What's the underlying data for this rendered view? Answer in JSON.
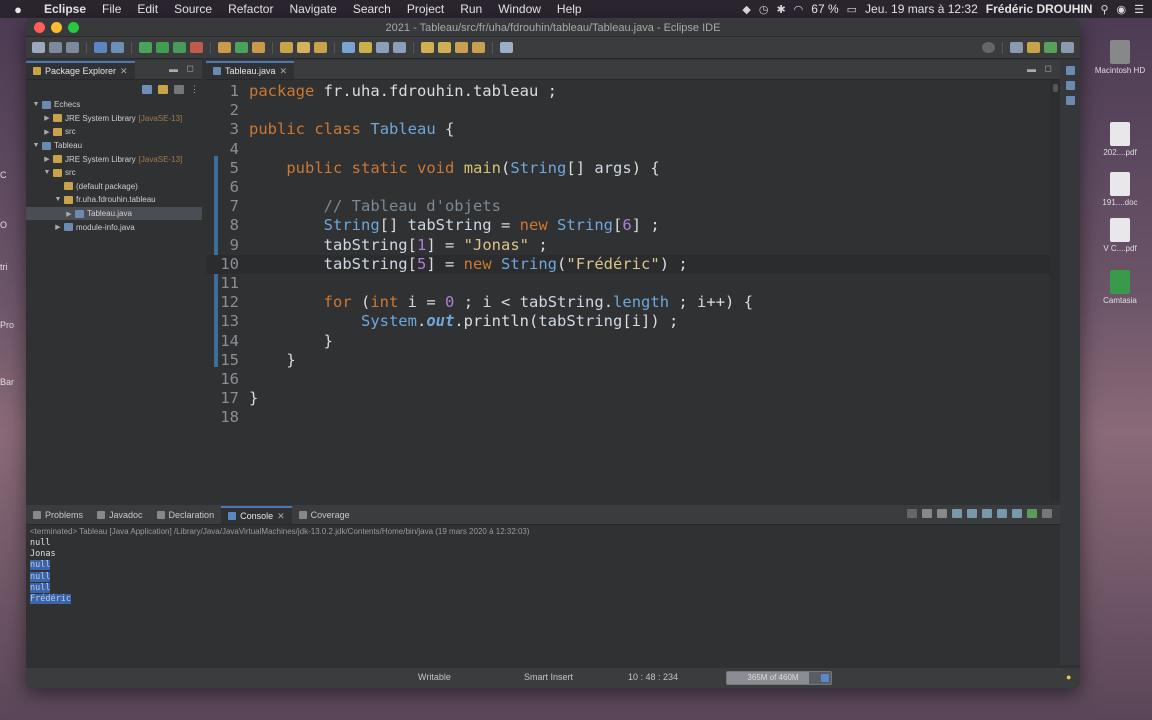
{
  "menubar": {
    "app": "Eclipse",
    "items": [
      "File",
      "Edit",
      "Source",
      "Refactor",
      "Navigate",
      "Search",
      "Project",
      "Run",
      "Window",
      "Help"
    ],
    "battery": "67 %",
    "datetime": "Jeu. 19 mars à 12:32",
    "user": "Frédéric DROUHIN"
  },
  "desktop": {
    "icons": [
      {
        "label": "Macintosh HD",
        "icon": "drive-icon"
      },
      {
        "label": "202....pdf",
        "icon": "pdf-file-icon"
      },
      {
        "label": "191....doc",
        "icon": "doc-file-icon"
      },
      {
        "label": "V C....pdf",
        "icon": "pdf-file-icon"
      },
      {
        "label": "Camtasia",
        "icon": "camtasia-icon"
      }
    ],
    "left_edge": [
      "C",
      "O",
      "tri",
      "Pro",
      "Bar"
    ]
  },
  "window": {
    "title": "2021 - Tableau/src/fr/uha/fdrouhin/tableau/Tableau.java - Eclipse IDE"
  },
  "package_explorer": {
    "tab_label": "Package Explorer",
    "tree": [
      {
        "label": "Echecs",
        "indent": 0,
        "arrow": "▼",
        "icon": "project"
      },
      {
        "label": "JRE System Library",
        "extra": "[JavaSE-13]",
        "indent": 1,
        "arrow": "▶",
        "icon": "library"
      },
      {
        "label": "src",
        "indent": 1,
        "arrow": "▶",
        "icon": "folder"
      },
      {
        "label": "Tableau",
        "indent": 0,
        "arrow": "▼",
        "icon": "project"
      },
      {
        "label": "JRE System Library",
        "extra": "[JavaSE-13]",
        "indent": 1,
        "arrow": "▶",
        "icon": "library"
      },
      {
        "label": "src",
        "indent": 1,
        "arrow": "▼",
        "icon": "folder"
      },
      {
        "label": "(default package)",
        "indent": 2,
        "arrow": "",
        "icon": "package"
      },
      {
        "label": "fr.uha.fdrouhin.tableau",
        "indent": 2,
        "arrow": "▼",
        "icon": "package"
      },
      {
        "label": "Tableau.java",
        "indent": 3,
        "arrow": "▶",
        "icon": "java-file",
        "selected": true
      },
      {
        "label": "module-info.java",
        "indent": 2,
        "arrow": "▶",
        "icon": "java-file"
      }
    ]
  },
  "editor": {
    "tab_label": "Tableau.java",
    "lines": [
      {
        "n": "1",
        "tokens": [
          [
            "kw",
            "package"
          ],
          [
            "pl",
            " fr.uha.fdrouhin.tableau ;"
          ]
        ]
      },
      {
        "n": "2",
        "tokens": []
      },
      {
        "n": "3",
        "tokens": [
          [
            "kw",
            "public"
          ],
          [
            "pl",
            " "
          ],
          [
            "kw",
            "class"
          ],
          [
            "pl",
            " "
          ],
          [
            "ty",
            "Tableau"
          ],
          [
            "pl",
            " {"
          ]
        ]
      },
      {
        "n": "4",
        "tokens": []
      },
      {
        "n": "5",
        "tokens": [
          [
            "pl",
            "    "
          ],
          [
            "kw",
            "public"
          ],
          [
            "pl",
            " "
          ],
          [
            "kw",
            "static"
          ],
          [
            "pl",
            " "
          ],
          [
            "kw",
            "void"
          ],
          [
            "pl",
            " "
          ],
          [
            "fn",
            "main"
          ],
          [
            "pl",
            "("
          ],
          [
            "ty",
            "String"
          ],
          [
            "pl",
            "[] "
          ],
          [
            "var",
            "args"
          ],
          [
            "pl",
            ") {"
          ]
        ]
      },
      {
        "n": "6",
        "tokens": []
      },
      {
        "n": "7",
        "tokens": [
          [
            "pl",
            "        "
          ],
          [
            "cm",
            "// Tableau d'objets"
          ]
        ]
      },
      {
        "n": "8",
        "tokens": [
          [
            "pl",
            "        "
          ],
          [
            "ty",
            "String"
          ],
          [
            "pl",
            "[] "
          ],
          [
            "var",
            "tabString"
          ],
          [
            "pl",
            " = "
          ],
          [
            "kw",
            "new"
          ],
          [
            "pl",
            " "
          ],
          [
            "ty",
            "String"
          ],
          [
            "pl",
            "["
          ],
          [
            "num",
            "6"
          ],
          [
            "pl",
            "] ;"
          ]
        ]
      },
      {
        "n": "9",
        "tokens": [
          [
            "pl",
            "        "
          ],
          [
            "var",
            "tabString"
          ],
          [
            "pl",
            "["
          ],
          [
            "num",
            "1"
          ],
          [
            "pl",
            "] = "
          ],
          [
            "str",
            "\"Jonas\""
          ],
          [
            "pl",
            " ;"
          ]
        ]
      },
      {
        "n": "10",
        "tokens": [
          [
            "pl",
            "        "
          ],
          [
            "var",
            "tabString"
          ],
          [
            "pl",
            "["
          ],
          [
            "num",
            "5"
          ],
          [
            "pl",
            "] = "
          ],
          [
            "kw",
            "new"
          ],
          [
            "pl",
            " "
          ],
          [
            "ty",
            "String"
          ],
          [
            "pl",
            "("
          ],
          [
            "str",
            "\"Frédéric\""
          ],
          [
            "pl",
            ") ;"
          ]
        ],
        "current": true
      },
      {
        "n": "11",
        "tokens": []
      },
      {
        "n": "12",
        "tokens": [
          [
            "pl",
            "        "
          ],
          [
            "kw",
            "for"
          ],
          [
            "pl",
            " ("
          ],
          [
            "kw",
            "int"
          ],
          [
            "pl",
            " "
          ],
          [
            "var",
            "i"
          ],
          [
            "pl",
            " = "
          ],
          [
            "num",
            "0"
          ],
          [
            "pl",
            " ; "
          ],
          [
            "var",
            "i"
          ],
          [
            "pl",
            " < "
          ],
          [
            "var",
            "tabString"
          ],
          [
            "pl",
            "."
          ],
          [
            "fld",
            "length"
          ],
          [
            "pl",
            " ; "
          ],
          [
            "var",
            "i"
          ],
          [
            "pl",
            "++) {"
          ]
        ]
      },
      {
        "n": "13",
        "tokens": [
          [
            "pl",
            "            "
          ],
          [
            "ty",
            "System"
          ],
          [
            "pl",
            "."
          ],
          [
            "it",
            "out"
          ],
          [
            "pl",
            ".println("
          ],
          [
            "var",
            "tabString"
          ],
          [
            "pl",
            "["
          ],
          [
            "var",
            "i"
          ],
          [
            "pl",
            "]) ;"
          ]
        ]
      },
      {
        "n": "14",
        "tokens": [
          [
            "pl",
            "        }"
          ]
        ]
      },
      {
        "n": "15",
        "tokens": [
          [
            "pl",
            "    }"
          ]
        ]
      },
      {
        "n": "16",
        "tokens": []
      },
      {
        "n": "17",
        "tokens": [
          [
            "pl",
            "}"
          ]
        ]
      },
      {
        "n": "18",
        "tokens": []
      }
    ]
  },
  "bottom_panel": {
    "tabs": [
      {
        "label": "Problems",
        "icon": "problems-icon"
      },
      {
        "label": "Javadoc",
        "icon": "javadoc-icon"
      },
      {
        "label": "Declaration",
        "icon": "declaration-icon"
      },
      {
        "label": "Console",
        "icon": "console-icon",
        "active": true
      },
      {
        "label": "Coverage",
        "icon": "coverage-icon"
      }
    ],
    "console_header": "<terminated> Tableau [Java Application] /Library/Java/JavaVirtualMachines/jdk-13.0.2.jdk/Contents/Home/bin/java (19 mars 2020 à 12:32:03)",
    "output": [
      "null",
      "Jonas",
      "null",
      "null",
      "null",
      "Frédéric"
    ]
  },
  "statusbar": {
    "writable": "Writable",
    "insert_mode": "Smart Insert",
    "position": "10 : 48 : 234",
    "heap": "365M of 460M",
    "heap_fraction": 0.79
  }
}
